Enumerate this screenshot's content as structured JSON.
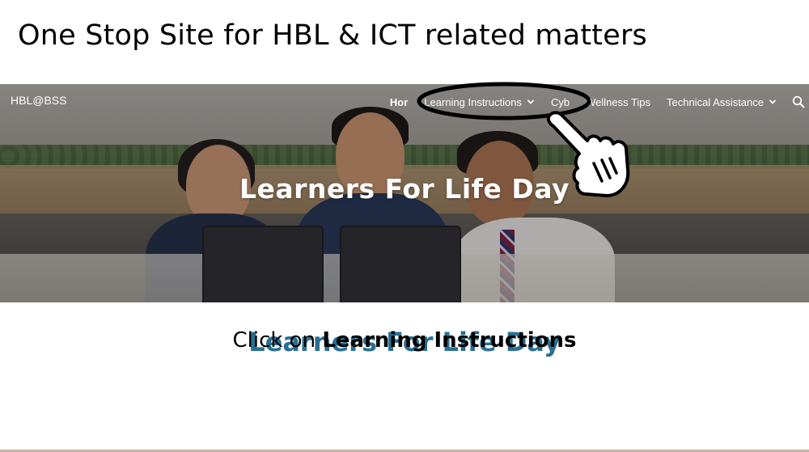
{
  "slide": {
    "title": "One Stop Site for HBL & ICT related matters"
  },
  "site": {
    "name": "HBL@BSS",
    "nav": {
      "home": "Hor",
      "learning_instructions": "Learning Instructions",
      "cyber": "Cyb",
      "wellness": "Wellness Tips",
      "technical": "Technical Assistance"
    },
    "hero_title": "Learners For Life Day",
    "page_heading": "Learners For Life Day"
  },
  "instruction": {
    "prefix": "Click on ",
    "emphasis": "Learning Instructions"
  },
  "colors": {
    "heading_blue": "#2a6f93",
    "nav_text": "#ffffff"
  },
  "icons": {
    "chevron": "chevron-down-icon",
    "search": "search-icon",
    "pointer": "pointing-hand-icon"
  }
}
